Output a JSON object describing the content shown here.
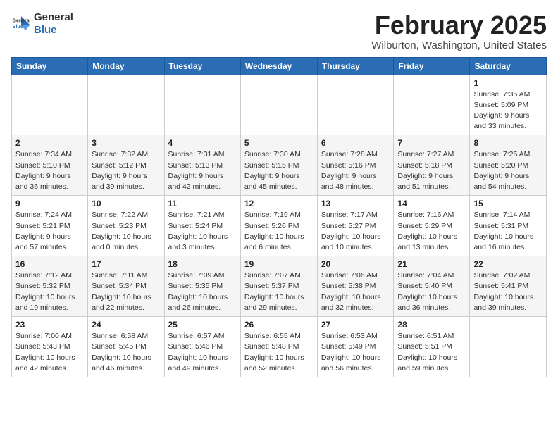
{
  "header": {
    "logo_general": "General",
    "logo_blue": "Blue",
    "month_title": "February 2025",
    "location": "Wilburton, Washington, United States"
  },
  "weekdays": [
    "Sunday",
    "Monday",
    "Tuesday",
    "Wednesday",
    "Thursday",
    "Friday",
    "Saturday"
  ],
  "weeks": [
    [
      {
        "day": "",
        "info": ""
      },
      {
        "day": "",
        "info": ""
      },
      {
        "day": "",
        "info": ""
      },
      {
        "day": "",
        "info": ""
      },
      {
        "day": "",
        "info": ""
      },
      {
        "day": "",
        "info": ""
      },
      {
        "day": "1",
        "info": "Sunrise: 7:35 AM\nSunset: 5:09 PM\nDaylight: 9 hours and 33 minutes."
      }
    ],
    [
      {
        "day": "2",
        "info": "Sunrise: 7:34 AM\nSunset: 5:10 PM\nDaylight: 9 hours and 36 minutes."
      },
      {
        "day": "3",
        "info": "Sunrise: 7:32 AM\nSunset: 5:12 PM\nDaylight: 9 hours and 39 minutes."
      },
      {
        "day": "4",
        "info": "Sunrise: 7:31 AM\nSunset: 5:13 PM\nDaylight: 9 hours and 42 minutes."
      },
      {
        "day": "5",
        "info": "Sunrise: 7:30 AM\nSunset: 5:15 PM\nDaylight: 9 hours and 45 minutes."
      },
      {
        "day": "6",
        "info": "Sunrise: 7:28 AM\nSunset: 5:16 PM\nDaylight: 9 hours and 48 minutes."
      },
      {
        "day": "7",
        "info": "Sunrise: 7:27 AM\nSunset: 5:18 PM\nDaylight: 9 hours and 51 minutes."
      },
      {
        "day": "8",
        "info": "Sunrise: 7:25 AM\nSunset: 5:20 PM\nDaylight: 9 hours and 54 minutes."
      }
    ],
    [
      {
        "day": "9",
        "info": "Sunrise: 7:24 AM\nSunset: 5:21 PM\nDaylight: 9 hours and 57 minutes."
      },
      {
        "day": "10",
        "info": "Sunrise: 7:22 AM\nSunset: 5:23 PM\nDaylight: 10 hours and 0 minutes."
      },
      {
        "day": "11",
        "info": "Sunrise: 7:21 AM\nSunset: 5:24 PM\nDaylight: 10 hours and 3 minutes."
      },
      {
        "day": "12",
        "info": "Sunrise: 7:19 AM\nSunset: 5:26 PM\nDaylight: 10 hours and 6 minutes."
      },
      {
        "day": "13",
        "info": "Sunrise: 7:17 AM\nSunset: 5:27 PM\nDaylight: 10 hours and 10 minutes."
      },
      {
        "day": "14",
        "info": "Sunrise: 7:16 AM\nSunset: 5:29 PM\nDaylight: 10 hours and 13 minutes."
      },
      {
        "day": "15",
        "info": "Sunrise: 7:14 AM\nSunset: 5:31 PM\nDaylight: 10 hours and 16 minutes."
      }
    ],
    [
      {
        "day": "16",
        "info": "Sunrise: 7:12 AM\nSunset: 5:32 PM\nDaylight: 10 hours and 19 minutes."
      },
      {
        "day": "17",
        "info": "Sunrise: 7:11 AM\nSunset: 5:34 PM\nDaylight: 10 hours and 22 minutes."
      },
      {
        "day": "18",
        "info": "Sunrise: 7:09 AM\nSunset: 5:35 PM\nDaylight: 10 hours and 26 minutes."
      },
      {
        "day": "19",
        "info": "Sunrise: 7:07 AM\nSunset: 5:37 PM\nDaylight: 10 hours and 29 minutes."
      },
      {
        "day": "20",
        "info": "Sunrise: 7:06 AM\nSunset: 5:38 PM\nDaylight: 10 hours and 32 minutes."
      },
      {
        "day": "21",
        "info": "Sunrise: 7:04 AM\nSunset: 5:40 PM\nDaylight: 10 hours and 36 minutes."
      },
      {
        "day": "22",
        "info": "Sunrise: 7:02 AM\nSunset: 5:41 PM\nDaylight: 10 hours and 39 minutes."
      }
    ],
    [
      {
        "day": "23",
        "info": "Sunrise: 7:00 AM\nSunset: 5:43 PM\nDaylight: 10 hours and 42 minutes."
      },
      {
        "day": "24",
        "info": "Sunrise: 6:58 AM\nSunset: 5:45 PM\nDaylight: 10 hours and 46 minutes."
      },
      {
        "day": "25",
        "info": "Sunrise: 6:57 AM\nSunset: 5:46 PM\nDaylight: 10 hours and 49 minutes."
      },
      {
        "day": "26",
        "info": "Sunrise: 6:55 AM\nSunset: 5:48 PM\nDaylight: 10 hours and 52 minutes."
      },
      {
        "day": "27",
        "info": "Sunrise: 6:53 AM\nSunset: 5:49 PM\nDaylight: 10 hours and 56 minutes."
      },
      {
        "day": "28",
        "info": "Sunrise: 6:51 AM\nSunset: 5:51 PM\nDaylight: 10 hours and 59 minutes."
      },
      {
        "day": "",
        "info": ""
      }
    ]
  ]
}
